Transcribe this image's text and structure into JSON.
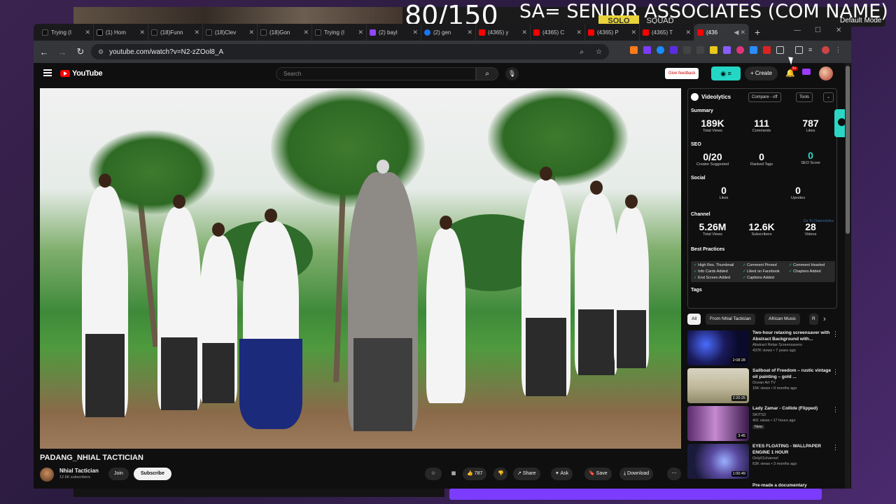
{
  "overlay": {
    "counter": "80/150",
    "banner": "SA= SENIOR ASSOCIATES (COM NAME)",
    "solo": "SOLO",
    "squad": "SQUAD",
    "mode": "Default Mode"
  },
  "browser": {
    "tabs": [
      {
        "label": "Trying (I",
        "icon": "tiktok"
      },
      {
        "label": "(1) Hom",
        "icon": "x"
      },
      {
        "label": "(18)Funn",
        "icon": "tiktok"
      },
      {
        "label": "(18)Clev",
        "icon": "tiktok"
      },
      {
        "label": "(18)Gon",
        "icon": "tiktok"
      },
      {
        "label": "Trying (I",
        "icon": "tiktok"
      },
      {
        "label": "(2) bayl",
        "icon": "twitch"
      },
      {
        "label": "(2) gen",
        "icon": "fb"
      },
      {
        "label": "(4365) y",
        "icon": "yt"
      },
      {
        "label": "(4365) C",
        "icon": "yt"
      },
      {
        "label": "(4365) P",
        "icon": "yt"
      },
      {
        "label": "(4365) T",
        "icon": "yt"
      },
      {
        "label": "(436",
        "icon": "yt"
      }
    ],
    "url": "youtube.com/watch?v=N2-zZOol8_A"
  },
  "youtube": {
    "logo": "YouTube",
    "search_placeholder": "Search",
    "feedback": "Give feedback",
    "create": "Create",
    "notif_count": "9+"
  },
  "video": {
    "title": "PADANG_NHIAL TACTICIAN",
    "channel": "Nhial Tactician",
    "subscribers": "12.6K subscribers",
    "join": "Join",
    "subscribe": "Subscribe",
    "likes": "787",
    "share": "Share",
    "ask": "Ask",
    "save": "Save",
    "download": "Download"
  },
  "videolytics": {
    "brand": "Videolytics",
    "compare": "Compare - off",
    "tools": "Tools",
    "summary_title": "Summary",
    "summary": [
      {
        "value": "189K",
        "label": "Total Views"
      },
      {
        "value": "111",
        "label": "Comments"
      },
      {
        "value": "787",
        "label": "Likes"
      }
    ],
    "seo_title": "SEO",
    "seo": [
      {
        "value": "0/20",
        "label": "Creator Suggested"
      },
      {
        "value": "0",
        "label": "Ranked Tags"
      },
      {
        "value": "0",
        "label": "SEO Score"
      }
    ],
    "social_title": "Social",
    "social": [
      {
        "value": "0",
        "label": "Likes"
      },
      {
        "value": "0",
        "label": "Upvotes"
      }
    ],
    "channel_title": "Channel",
    "goto": "Go To Channelytics",
    "channel": [
      {
        "value": "5.26M",
        "label": "Total Views"
      },
      {
        "value": "12.6K",
        "label": "Subscribers"
      },
      {
        "value": "28",
        "label": "Videos"
      }
    ],
    "bp_title": "Best Practices",
    "best_practices": [
      "High Res. Thumbnail",
      "Comment Pinned",
      "Comment Hearted",
      "Info Cards Added",
      "Liked on Facebook",
      "Chapters Added",
      "End Screen Added",
      "Captions Added"
    ],
    "tags_title": "Tags"
  },
  "chips": [
    "All",
    "From Nhial Tactician",
    "African Music",
    "R"
  ],
  "recommendations": [
    {
      "title": "Two-hour relaxing screensaver with Abstract Background with...",
      "channel": "Abstract Relax Screensavers",
      "meta": "437K views • 7 years ago",
      "duration": "2:08:28",
      "new": ""
    },
    {
      "title": "Sailboat of Freedom – rustic vintage oil painting – gold ...",
      "channel": "Ocean Art TV",
      "meta": "15K views • 9 months ago",
      "duration": "2:20:25",
      "new": ""
    },
    {
      "title": "Lady Zamar - Collide (Flipped)",
      "channel": "SKITS3",
      "meta": "401 views • 17 hours ago",
      "duration": "3:45",
      "new": "New"
    },
    {
      "title": "EYES FLOATING - WALLPAPER ENGINE 1 HOUR",
      "channel": "Only01channel",
      "meta": "63K views • 3 months ago",
      "duration": "1:00:49",
      "new": ""
    },
    {
      "title": "Pre-made a documentary",
      "channel": "",
      "meta": "",
      "duration": "",
      "new": ""
    }
  ]
}
